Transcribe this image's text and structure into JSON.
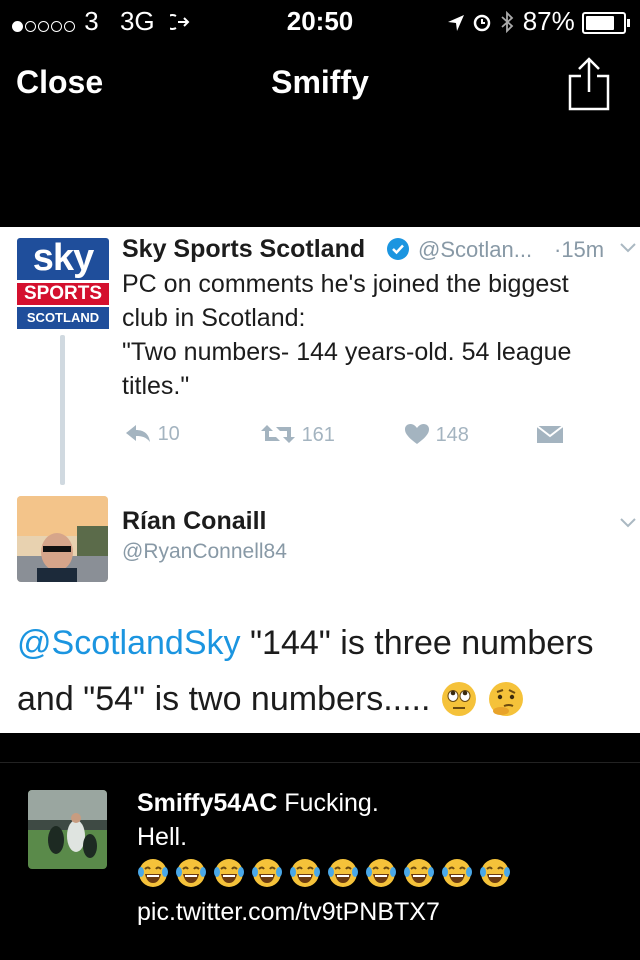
{
  "status_bar": {
    "carrier": "3",
    "network": "3G",
    "time": "20:50",
    "battery": "87%",
    "battery_level": 0.87
  },
  "nav": {
    "close_label": "Close",
    "title": "Smiffy",
    "share_icon": "share-icon"
  },
  "quoted_tweet": {
    "display_name": "Sky Sports Scotland",
    "handle": "@Scotlan...",
    "time": "·15m",
    "text_line1": "PC on comments he's joined the biggest",
    "text_line2": "club in Scotland:",
    "text_line3": "\"Two numbers- 144 years-old. 54 league",
    "text_line4": "titles.\"",
    "logo_top": "sky",
    "logo_mid": "SPORTS",
    "logo_bot": "SCOTLAND",
    "reply_count": "10",
    "retweet_count": "161",
    "like_count": "148"
  },
  "reply_tweet": {
    "display_name": "Rían Conaill",
    "handle": "@RyanConnell84",
    "mention": "@ScotlandSky",
    "text_part1": " \"144\" is three numbers",
    "text_part2": "and \"54\" is two numbers....."
  },
  "main_tweet": {
    "username": "Smiffy54AC",
    "text_line1": "Fucking.",
    "text_line2": "Hell.",
    "laugh_count": 10,
    "link": "pic.twitter.com/tv9tPNBTX7"
  },
  "colors": {
    "link_blue": "#1b95e0",
    "muted_gray": "#8899a6",
    "sky_red": "#d4102e",
    "sky_blue": "#1f4e9b"
  }
}
